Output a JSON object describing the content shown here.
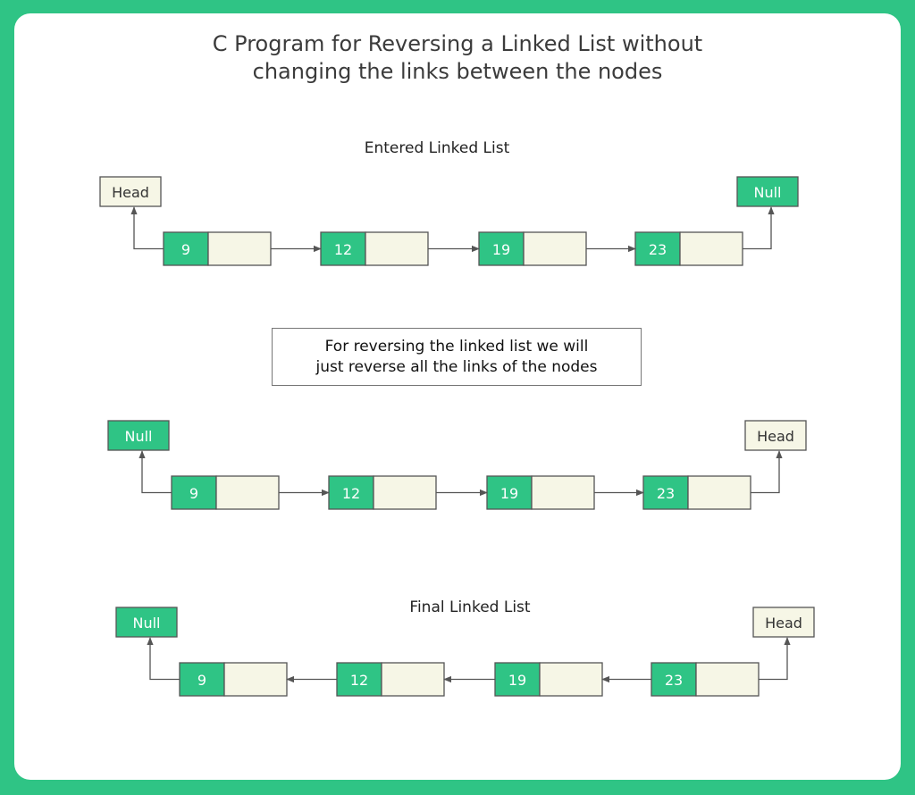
{
  "title_line1": "C Program for Reversing a Linked List without",
  "title_line2": "changing the links between the nodes",
  "colors": {
    "background": "#2fc485",
    "node_value": "#2fc485",
    "node_pointer": "#f6f6e6",
    "null_box": "#2fc485",
    "head_box": "#f6f6e6",
    "line": "#555555"
  },
  "sections": [
    {
      "label": "Entered Linked List",
      "left_tag": "Head",
      "right_tag": "Null",
      "direction": "forward",
      "nodes": [
        "9",
        "12",
        "19",
        "23"
      ]
    },
    {
      "label": "",
      "left_tag": "Null",
      "right_tag": "Head",
      "direction": "forward",
      "nodes": [
        "9",
        "12",
        "19",
        "23"
      ]
    },
    {
      "label": "Final Linked List",
      "left_tag": "Null",
      "right_tag": "Head",
      "direction": "backward",
      "nodes": [
        "9",
        "12",
        "19",
        "23"
      ]
    }
  ],
  "note_line1": "For reversing the linked list we will",
  "note_line2": "just reverse all the links of the nodes"
}
